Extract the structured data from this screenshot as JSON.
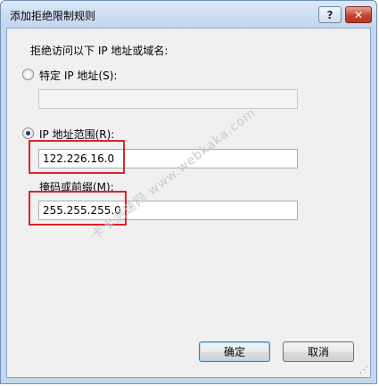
{
  "window": {
    "title": "添加拒绝限制规则",
    "help_button": "?",
    "close_button": "✕"
  },
  "dialog": {
    "instruction": "拒绝访问以下 IP 地址或域名:",
    "specific_ip": {
      "label": "特定 IP 地址(S):",
      "selected": false,
      "value": ""
    },
    "ip_range": {
      "label": "IP 地址范围(R):",
      "selected": true,
      "value": "122.226.16.0"
    },
    "mask": {
      "label": "掩码或前缀(M):",
      "value": "255.255.255.0"
    }
  },
  "buttons": {
    "ok": "确定",
    "cancel": "取消"
  },
  "watermark": {
    "text": "卡卡测速网 www.webkaka.com"
  },
  "colors": {
    "highlight": "#e0222a",
    "title_bar": "#c4d7ee",
    "close_button": "#c5452e"
  }
}
